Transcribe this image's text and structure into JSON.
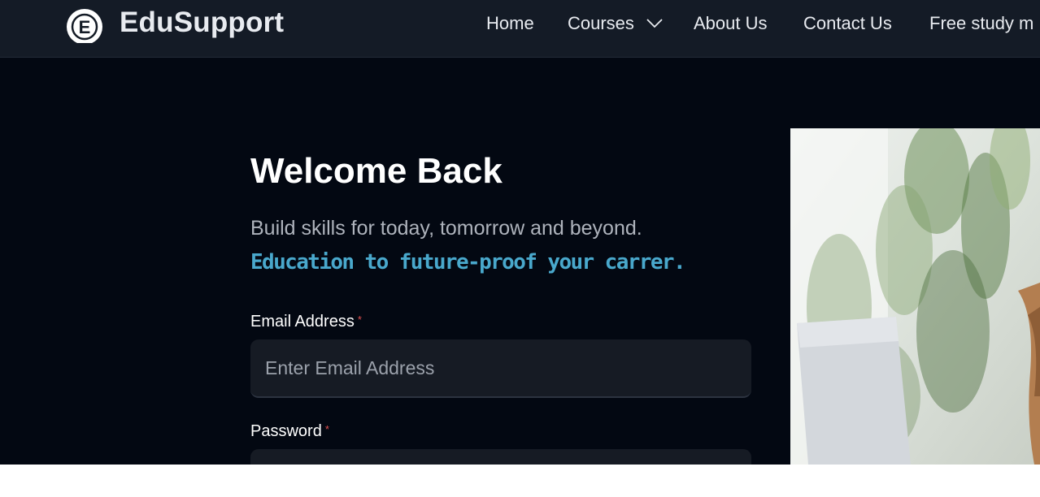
{
  "brand": {
    "name": "EduSupport",
    "logo_letter": "E"
  },
  "nav": {
    "home": "Home",
    "courses": "Courses",
    "about": "About Us",
    "contact": "Contact Us",
    "free_study": "Free study m"
  },
  "login": {
    "title": "Welcome Back",
    "subtitle": "Build skills for today, tomorrow and beyond.",
    "tagline": "Education to future-proof your carrer.",
    "email_label": "Email Address",
    "email_placeholder": "Enter Email Address",
    "password_label": "Password",
    "required_mark": "*"
  },
  "icons": {
    "logo": "edusupport-logo-icon",
    "courses_dropdown": "chevron-down-icon"
  },
  "colors": {
    "page_bg": "#030812",
    "navbar_bg": "#141b26",
    "input_bg": "#161b24",
    "tagline": "#49a8cc",
    "required": "#e05050"
  }
}
